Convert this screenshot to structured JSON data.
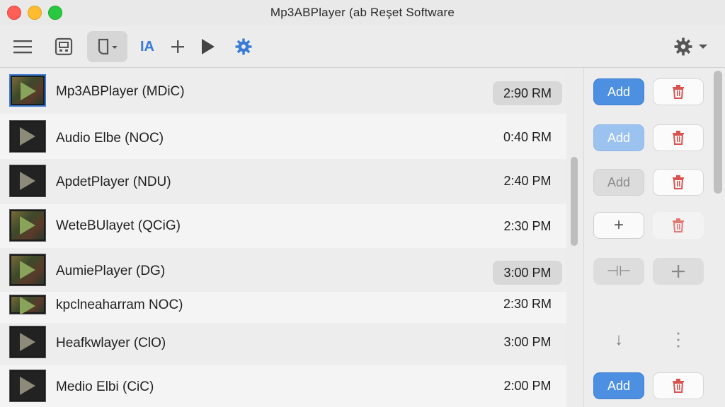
{
  "window": {
    "title": "Mp3ABPlayer (ab Reşet Software"
  },
  "toolbar": {
    "items": [
      "menu-icon",
      "save-icon",
      "device-dropdown-icon",
      "text-format-icon",
      "add-icon",
      "play-icon",
      "settings-gear-icon"
    ],
    "text_format_label": "IA",
    "gear_menu": "settings-gear-icon"
  },
  "tracks": [
    {
      "name": "Mp3ABPlayer (MDiC)",
      "time": "2:90 RM",
      "time_pill": true,
      "selected": true,
      "action": "Add",
      "action_style": "blue"
    },
    {
      "name": "Audio Elbe (NOC)",
      "time": "0:40 RM",
      "action": "Add",
      "action_style": "lightblue"
    },
    {
      "name": "ApdetPlayer (NDU)",
      "time": "2:40 PM",
      "action": "Add",
      "action_style": "gray"
    },
    {
      "name": "WeteBUlayet (QCiG)",
      "time": "2:30 PM",
      "action": "+",
      "action_style": "outline"
    },
    {
      "name": "AumiePlayer (DG)",
      "time": "3:00 PM",
      "time_pill": true,
      "action": "⊣⊢",
      "action_style": "flat"
    },
    {
      "name": "kpclneaharram NOC)",
      "time": "2:30 RM"
    },
    {
      "name": "Heafkwlayer (ClO)",
      "time": "3:00 PM",
      "action": "↓",
      "action_style": "plain"
    },
    {
      "name": "Medio Elbi (CiC)",
      "time": "2:00 PM",
      "action": "Add",
      "action_style": "blue"
    }
  ],
  "colors": {
    "accent": "#4d8fe0",
    "trash": "#d9534f"
  }
}
